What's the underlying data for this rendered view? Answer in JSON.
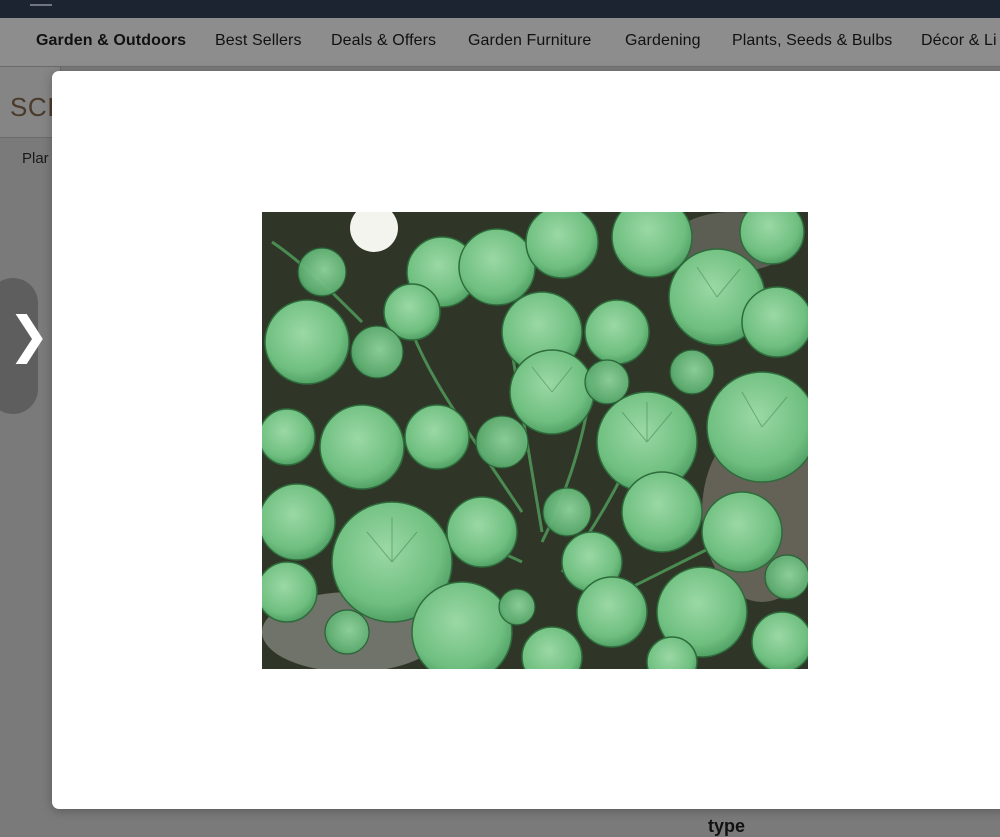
{
  "subnav": {
    "items": [
      {
        "label": "Garden & Outdoors",
        "bold": true
      },
      {
        "label": "Best Sellers"
      },
      {
        "label": "Deals & Offers"
      },
      {
        "label": "Garden Furniture"
      },
      {
        "label": "Gardening"
      },
      {
        "label": "Plants, Seeds & Bulbs"
      },
      {
        "label": "Décor & Li"
      }
    ]
  },
  "background": {
    "logo_fragment": "SCI",
    "breadcrumb_fragment": "Plar",
    "type_fragment": "type"
  },
  "modal": {
    "image": {
      "icon": "plant-photo",
      "subject": "low-growing plant with round green leaves on soil"
    }
  },
  "colors": {
    "overlay": "#7a7a7a",
    "modal_bg": "#ffffff",
    "leaf_green": "#7cc48a"
  }
}
